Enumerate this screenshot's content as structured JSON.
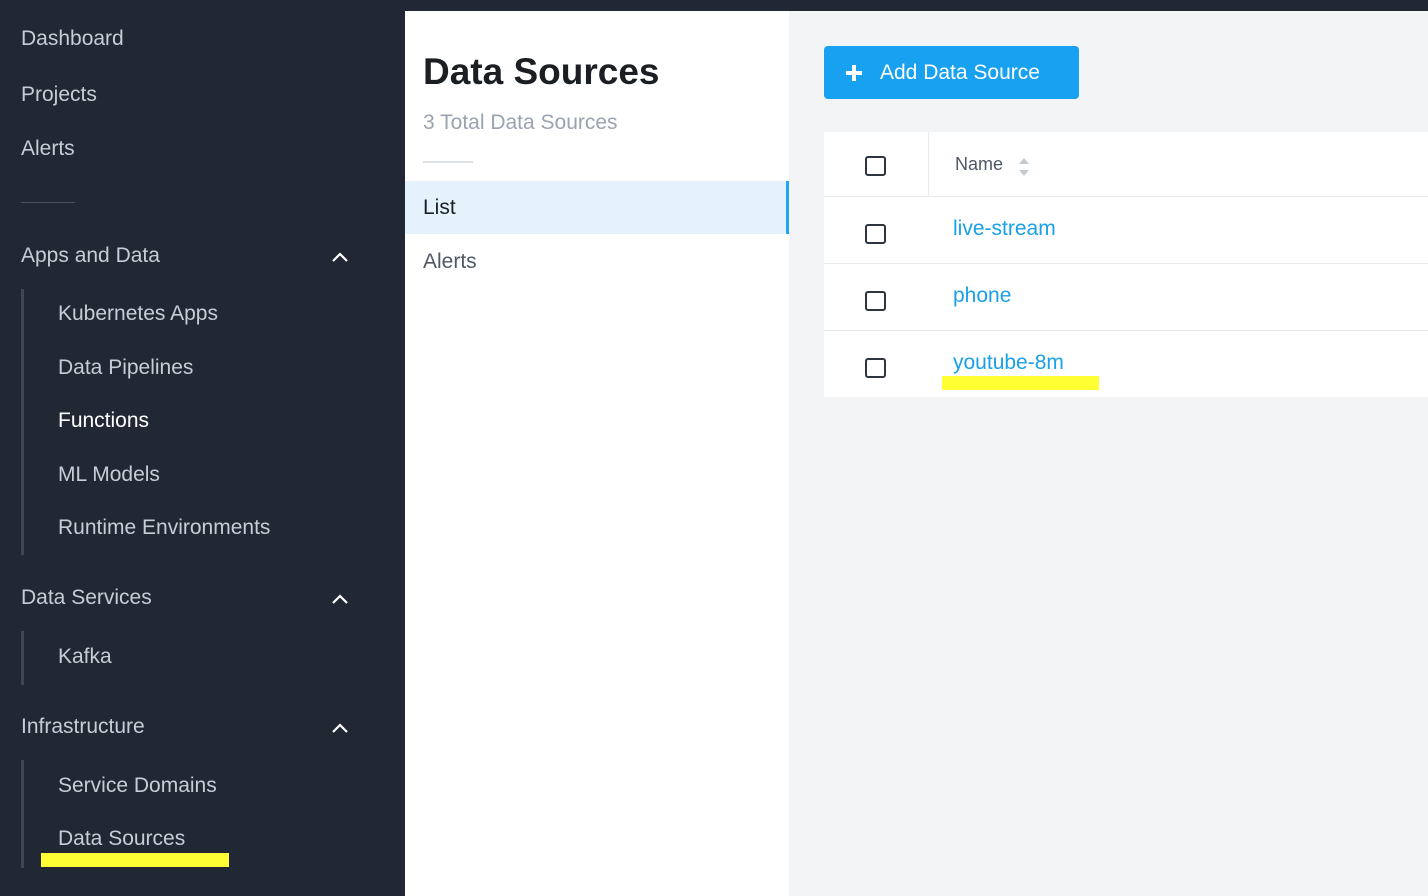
{
  "sidebar": {
    "top_items": [
      {
        "label": "Dashboard"
      },
      {
        "label": "Projects"
      },
      {
        "label": "Alerts"
      }
    ],
    "sections": [
      {
        "label": "Apps and Data",
        "items": [
          "Kubernetes Apps",
          "Data Pipelines",
          "Functions",
          "ML Models",
          "Runtime Environments"
        ]
      },
      {
        "label": "Data Services",
        "items": [
          "Kafka"
        ]
      },
      {
        "label": "Infrastructure",
        "items": [
          "Service Domains",
          "Data Sources"
        ]
      }
    ],
    "active_item": "Functions",
    "highlight_color": "#ffff33"
  },
  "panel": {
    "title": "Data Sources",
    "subtitle": "3 Total Data Sources",
    "tabs": [
      {
        "label": "List",
        "active": true
      },
      {
        "label": "Alerts",
        "active": false
      }
    ]
  },
  "main": {
    "add_button": {
      "label": "Add Data Source",
      "icon": "plus-icon"
    },
    "table": {
      "column_name": "Name",
      "rows": [
        {
          "name": "live-stream"
        },
        {
          "name": "phone"
        },
        {
          "name": "youtube-8m"
        }
      ]
    }
  },
  "colors": {
    "sidebar_bg": "#212833",
    "accent": "#17a1f0",
    "link": "#1aa0e8",
    "active_tab_bg": "#e4f3fb"
  }
}
